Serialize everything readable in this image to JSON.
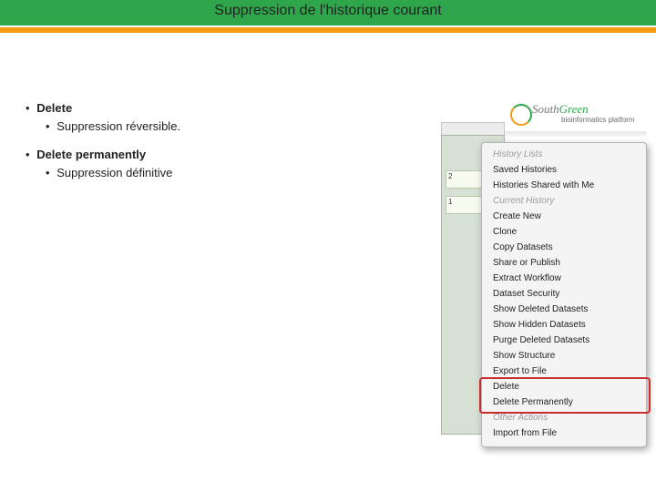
{
  "slide_title": "Suppression de l'historique courant",
  "text": {
    "delete_heading": "Delete",
    "delete_desc": "Suppression réversible.",
    "delete_perm_heading": "Delete permanently",
    "delete_perm_desc": "Suppression définitive"
  },
  "logo": {
    "south": "South",
    "green": "Green",
    "tagline": "bioinformatics platform"
  },
  "app_chips": [
    {
      "num": "2",
      "label": ""
    },
    {
      "num": "1",
      "label": ""
    }
  ],
  "menu": {
    "sections": [
      {
        "title": "History Lists",
        "items": [
          "Saved Histories",
          "Histories Shared with Me"
        ]
      },
      {
        "title": "Current History",
        "items": [
          "Create New",
          "Clone",
          "Copy Datasets",
          "Share or Publish",
          "Extract Workflow",
          "Dataset Security",
          "Show Deleted Datasets",
          "Show Hidden Datasets",
          "Purge Deleted Datasets",
          "Show Structure",
          "Export to File",
          "Delete",
          "Delete Permanently"
        ]
      },
      {
        "title": "Other Actions",
        "items": [
          "Import from File"
        ]
      }
    ]
  }
}
